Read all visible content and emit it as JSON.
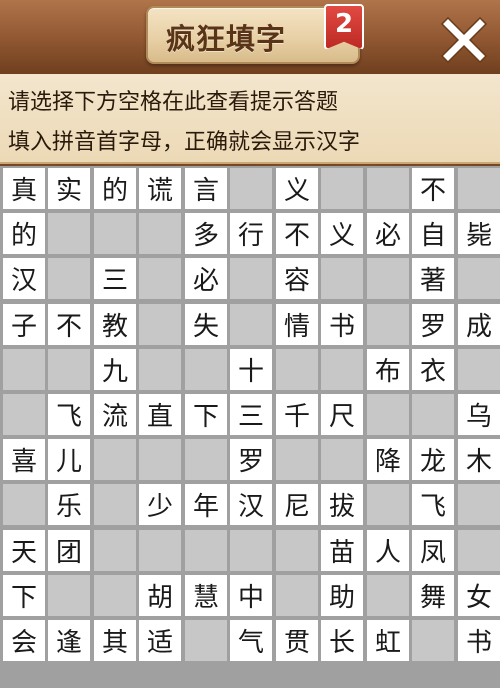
{
  "header": {
    "title": "疯狂填字",
    "level": "2",
    "close_icon": "close-x-icon"
  },
  "hint": {
    "line1": "请选择下方空格在此查看提示答题",
    "line2": "填入拼音首字母，正确就会显示汉字"
  },
  "board": {
    "columns": 11,
    "rows": 11,
    "cells": [
      [
        "真",
        "实",
        "的",
        "谎",
        "言",
        "",
        "义",
        "",
        "",
        "不",
        ""
      ],
      [
        "的",
        "",
        "",
        "",
        "多",
        "行",
        "不",
        "义",
        "必",
        "自",
        "毙"
      ],
      [
        "汉",
        "",
        "三",
        "",
        "必",
        "",
        "容",
        "",
        "",
        "著",
        ""
      ],
      [
        "子",
        "不",
        "教",
        "",
        "失",
        "",
        "情",
        "书",
        "",
        "罗",
        "成"
      ],
      [
        "",
        "",
        "九",
        "",
        "",
        "十",
        "",
        "",
        "布",
        "衣",
        ""
      ],
      [
        "",
        "飞",
        "流",
        "直",
        "下",
        "三",
        "千",
        "尺",
        "",
        "",
        "乌"
      ],
      [
        "喜",
        "儿",
        "",
        "",
        "",
        "罗",
        "",
        "",
        "降",
        "龙",
        "木"
      ],
      [
        "",
        "乐",
        "",
        "少",
        "年",
        "汉",
        "尼",
        "拔",
        "",
        "飞",
        ""
      ],
      [
        "天",
        "团",
        "",
        "",
        "",
        "",
        "",
        "苗",
        "人",
        "凤",
        ""
      ],
      [
        "下",
        "",
        "",
        "胡",
        "慧",
        "中",
        "",
        "助",
        "",
        "舞",
        "女"
      ],
      [
        "会",
        "逢",
        "其",
        "适",
        "",
        "气",
        "贯",
        "长",
        "虹",
        "",
        "书"
      ]
    ]
  }
}
